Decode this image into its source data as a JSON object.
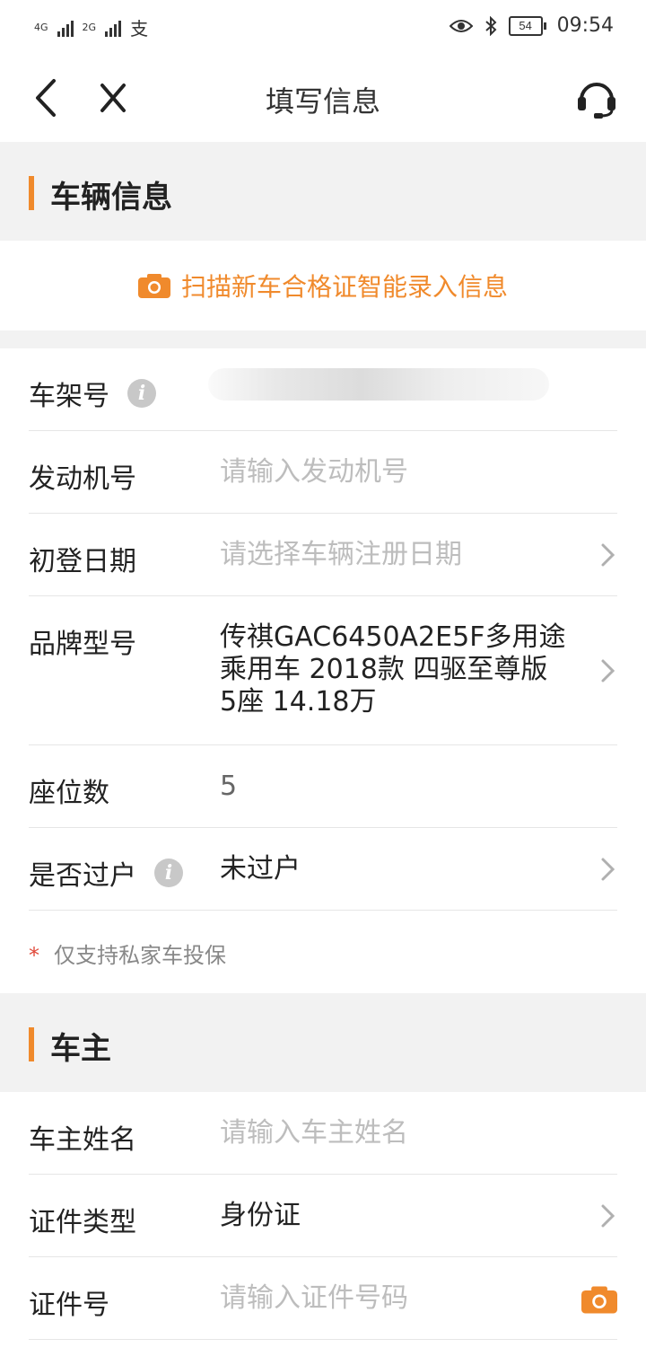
{
  "status_bar": {
    "network_1": "4G",
    "network_2": "2G",
    "pay_glyph": "支",
    "battery": "54",
    "time": "09:54"
  },
  "nav": {
    "title": "填写信息",
    "back_icon": "chevron-left-icon",
    "close_icon": "close-icon",
    "service_icon": "headset-icon"
  },
  "vehicle_section": {
    "title": "车辆信息",
    "scan_label": "扫描新车合格证智能录入信息",
    "rows": [
      {
        "label": "车架号",
        "value": "",
        "has_info": true
      },
      {
        "label": "发动机号",
        "placeholder": "请输入发动机号"
      },
      {
        "label": "初登日期",
        "placeholder": "请选择车辆注册日期"
      },
      {
        "label": "品牌型号",
        "value": "传祺GAC6450A2E5F多用途乘用车 2018款 四驱至尊版 5座 14.18万"
      },
      {
        "label": "座位数",
        "value": "5"
      },
      {
        "label": "是否过户",
        "value": "未过户",
        "has_info": true
      }
    ],
    "note": "仅支持私家车投保",
    "note_mark": "*"
  },
  "owner_section": {
    "title": "车主",
    "rows": [
      {
        "label": "车主姓名",
        "placeholder": "请输入车主姓名"
      },
      {
        "label": "证件类型",
        "value": "身份证"
      },
      {
        "label": "证件号",
        "placeholder": "请输入证件号码"
      }
    ]
  },
  "colors": {
    "accent": "#f08a2c",
    "section_bg": "#f2f2f2",
    "placeholder": "#bdbdbd"
  }
}
